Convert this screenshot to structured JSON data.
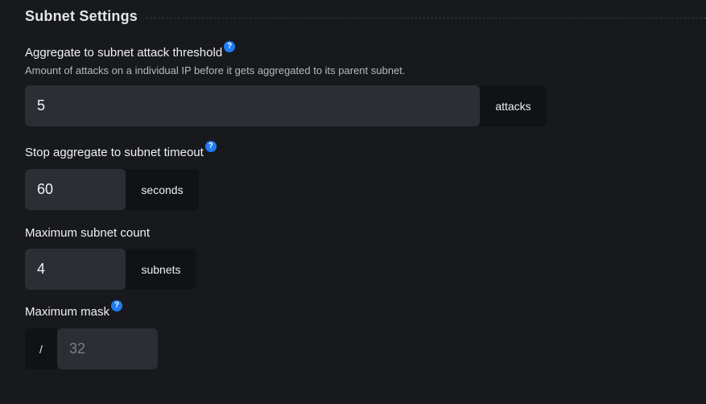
{
  "section": {
    "title": "Subnet Settings"
  },
  "fields": {
    "threshold": {
      "label": "Aggregate to subnet attack threshold",
      "help": "?",
      "description": "Amount of attacks on a individual IP before it gets aggregated to its parent subnet.",
      "value": "5",
      "unit": "attacks"
    },
    "timeout": {
      "label": "Stop aggregate to subnet timeout",
      "help": "?",
      "value": "60",
      "unit": "seconds"
    },
    "subnet_count": {
      "label": "Maximum subnet count",
      "value": "4",
      "unit": "subnets"
    },
    "mask": {
      "label": "Maximum mask",
      "help": "?",
      "prefix": "/",
      "placeholder": "32"
    }
  },
  "colors": {
    "background": "#18191d",
    "input": "#2b2e34",
    "addon": "#111215",
    "help_icon": "#1e7cf2"
  }
}
